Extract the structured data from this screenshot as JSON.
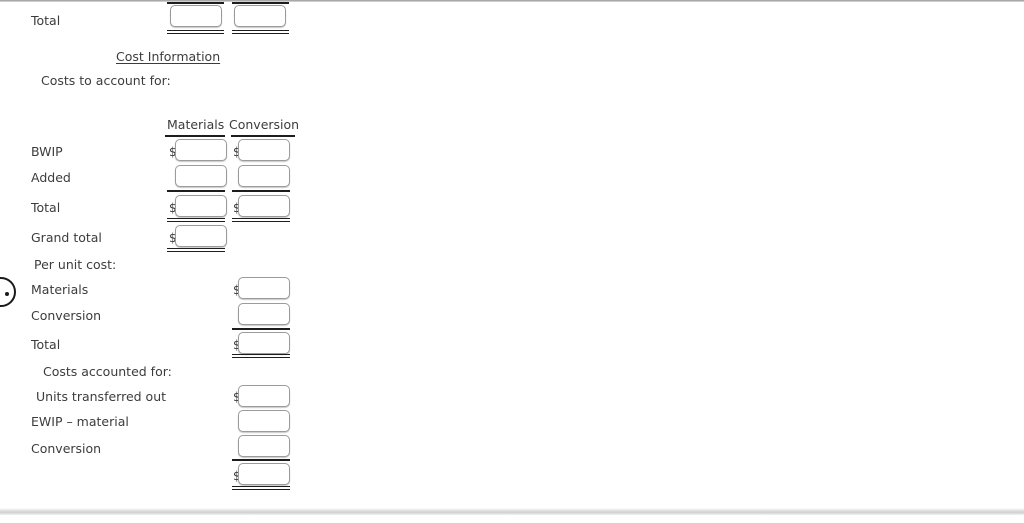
{
  "page": {
    "section_title": "Cost Information",
    "subsection_costs_to_account": "Costs to account for:",
    "subsection_costs_accounted": "Costs accounted for:",
    "per_unit_cost_label": "Per unit cost:",
    "currency_symbol": "$"
  },
  "columns": {
    "materials": "Materials",
    "conversion": "Conversion"
  },
  "top_section": {
    "total_label": "Total",
    "materials_value": "",
    "conversion_value": ""
  },
  "costs_to_account": {
    "rows": [
      {
        "label": "BWIP",
        "materials_value": "",
        "conversion_value": ""
      },
      {
        "label": "Added",
        "materials_value": "",
        "conversion_value": ""
      },
      {
        "label": "Total",
        "materials_value": "",
        "conversion_value": ""
      },
      {
        "label": "Grand total",
        "materials_value": ""
      }
    ]
  },
  "per_unit_cost": {
    "rows": [
      {
        "label": "Materials",
        "value": ""
      },
      {
        "label": "Conversion",
        "value": ""
      },
      {
        "label": "Total",
        "value": ""
      }
    ]
  },
  "costs_accounted": {
    "rows": [
      {
        "label": "Units transferred out",
        "value": ""
      },
      {
        "label": "EWIP – material",
        "value": ""
      },
      {
        "label": "Conversion",
        "value": ""
      },
      {
        "label": "",
        "value": ""
      }
    ]
  },
  "colors": {
    "text": "#3c3c3c",
    "rule": "#1d1d1d",
    "field_border": "#9b9b9b",
    "background": "#ffffff"
  }
}
